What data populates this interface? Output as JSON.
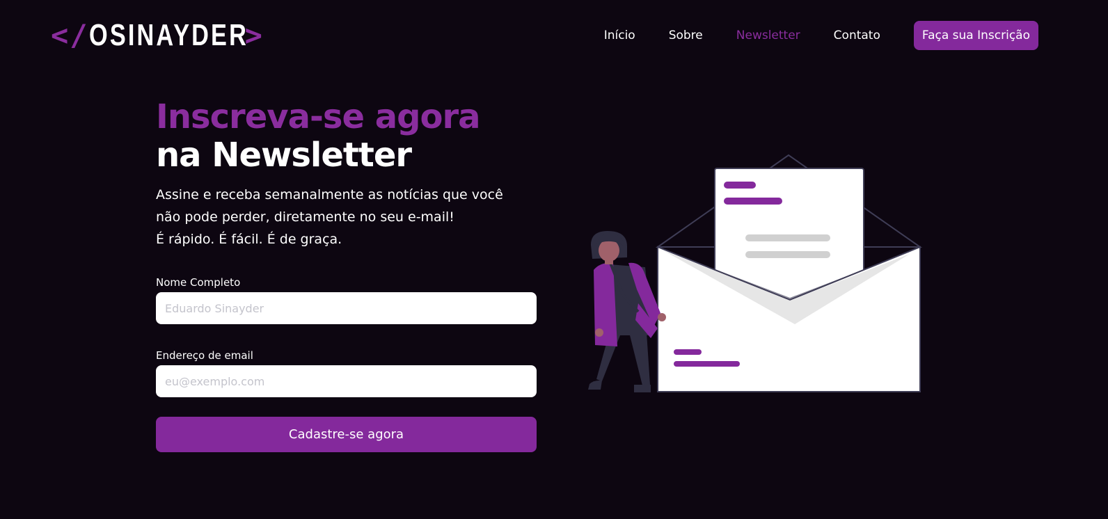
{
  "logo": {
    "open": "</",
    "name": "OSINAYDER",
    "close": ">"
  },
  "nav": {
    "items": [
      {
        "label": "Início",
        "active": false
      },
      {
        "label": "Sobre",
        "active": false
      },
      {
        "label": "Newsletter",
        "active": true
      },
      {
        "label": "Contato",
        "active": false
      }
    ],
    "cta_label": "Faça sua Inscrição"
  },
  "hero": {
    "title_line1": "Inscreva-se agora",
    "title_line2": "na Newsletter",
    "desc_line1": "Assine e receba semanalmente as notícias que você",
    "desc_line2": "não pode perder, diretamente no seu e-mail!",
    "desc_line3": "É rápido. É fácil. É de graça."
  },
  "form": {
    "name_label": "Nome Completo",
    "name_placeholder": "Eduardo Sinayder",
    "name_value": "",
    "email_label": "Endereço de email",
    "email_placeholder": "eu@exemplo.com",
    "email_value": "",
    "submit_label": "Cadastre-se agora"
  },
  "illustration": {
    "icon": "newsletter-envelope-illustration"
  },
  "colors": {
    "background": "#0d0611",
    "accent": "#84299c",
    "accent_text": "#8a2d9e",
    "text": "#ffffff",
    "input_bg": "#ffffff",
    "placeholder": "#c4c4cc"
  }
}
